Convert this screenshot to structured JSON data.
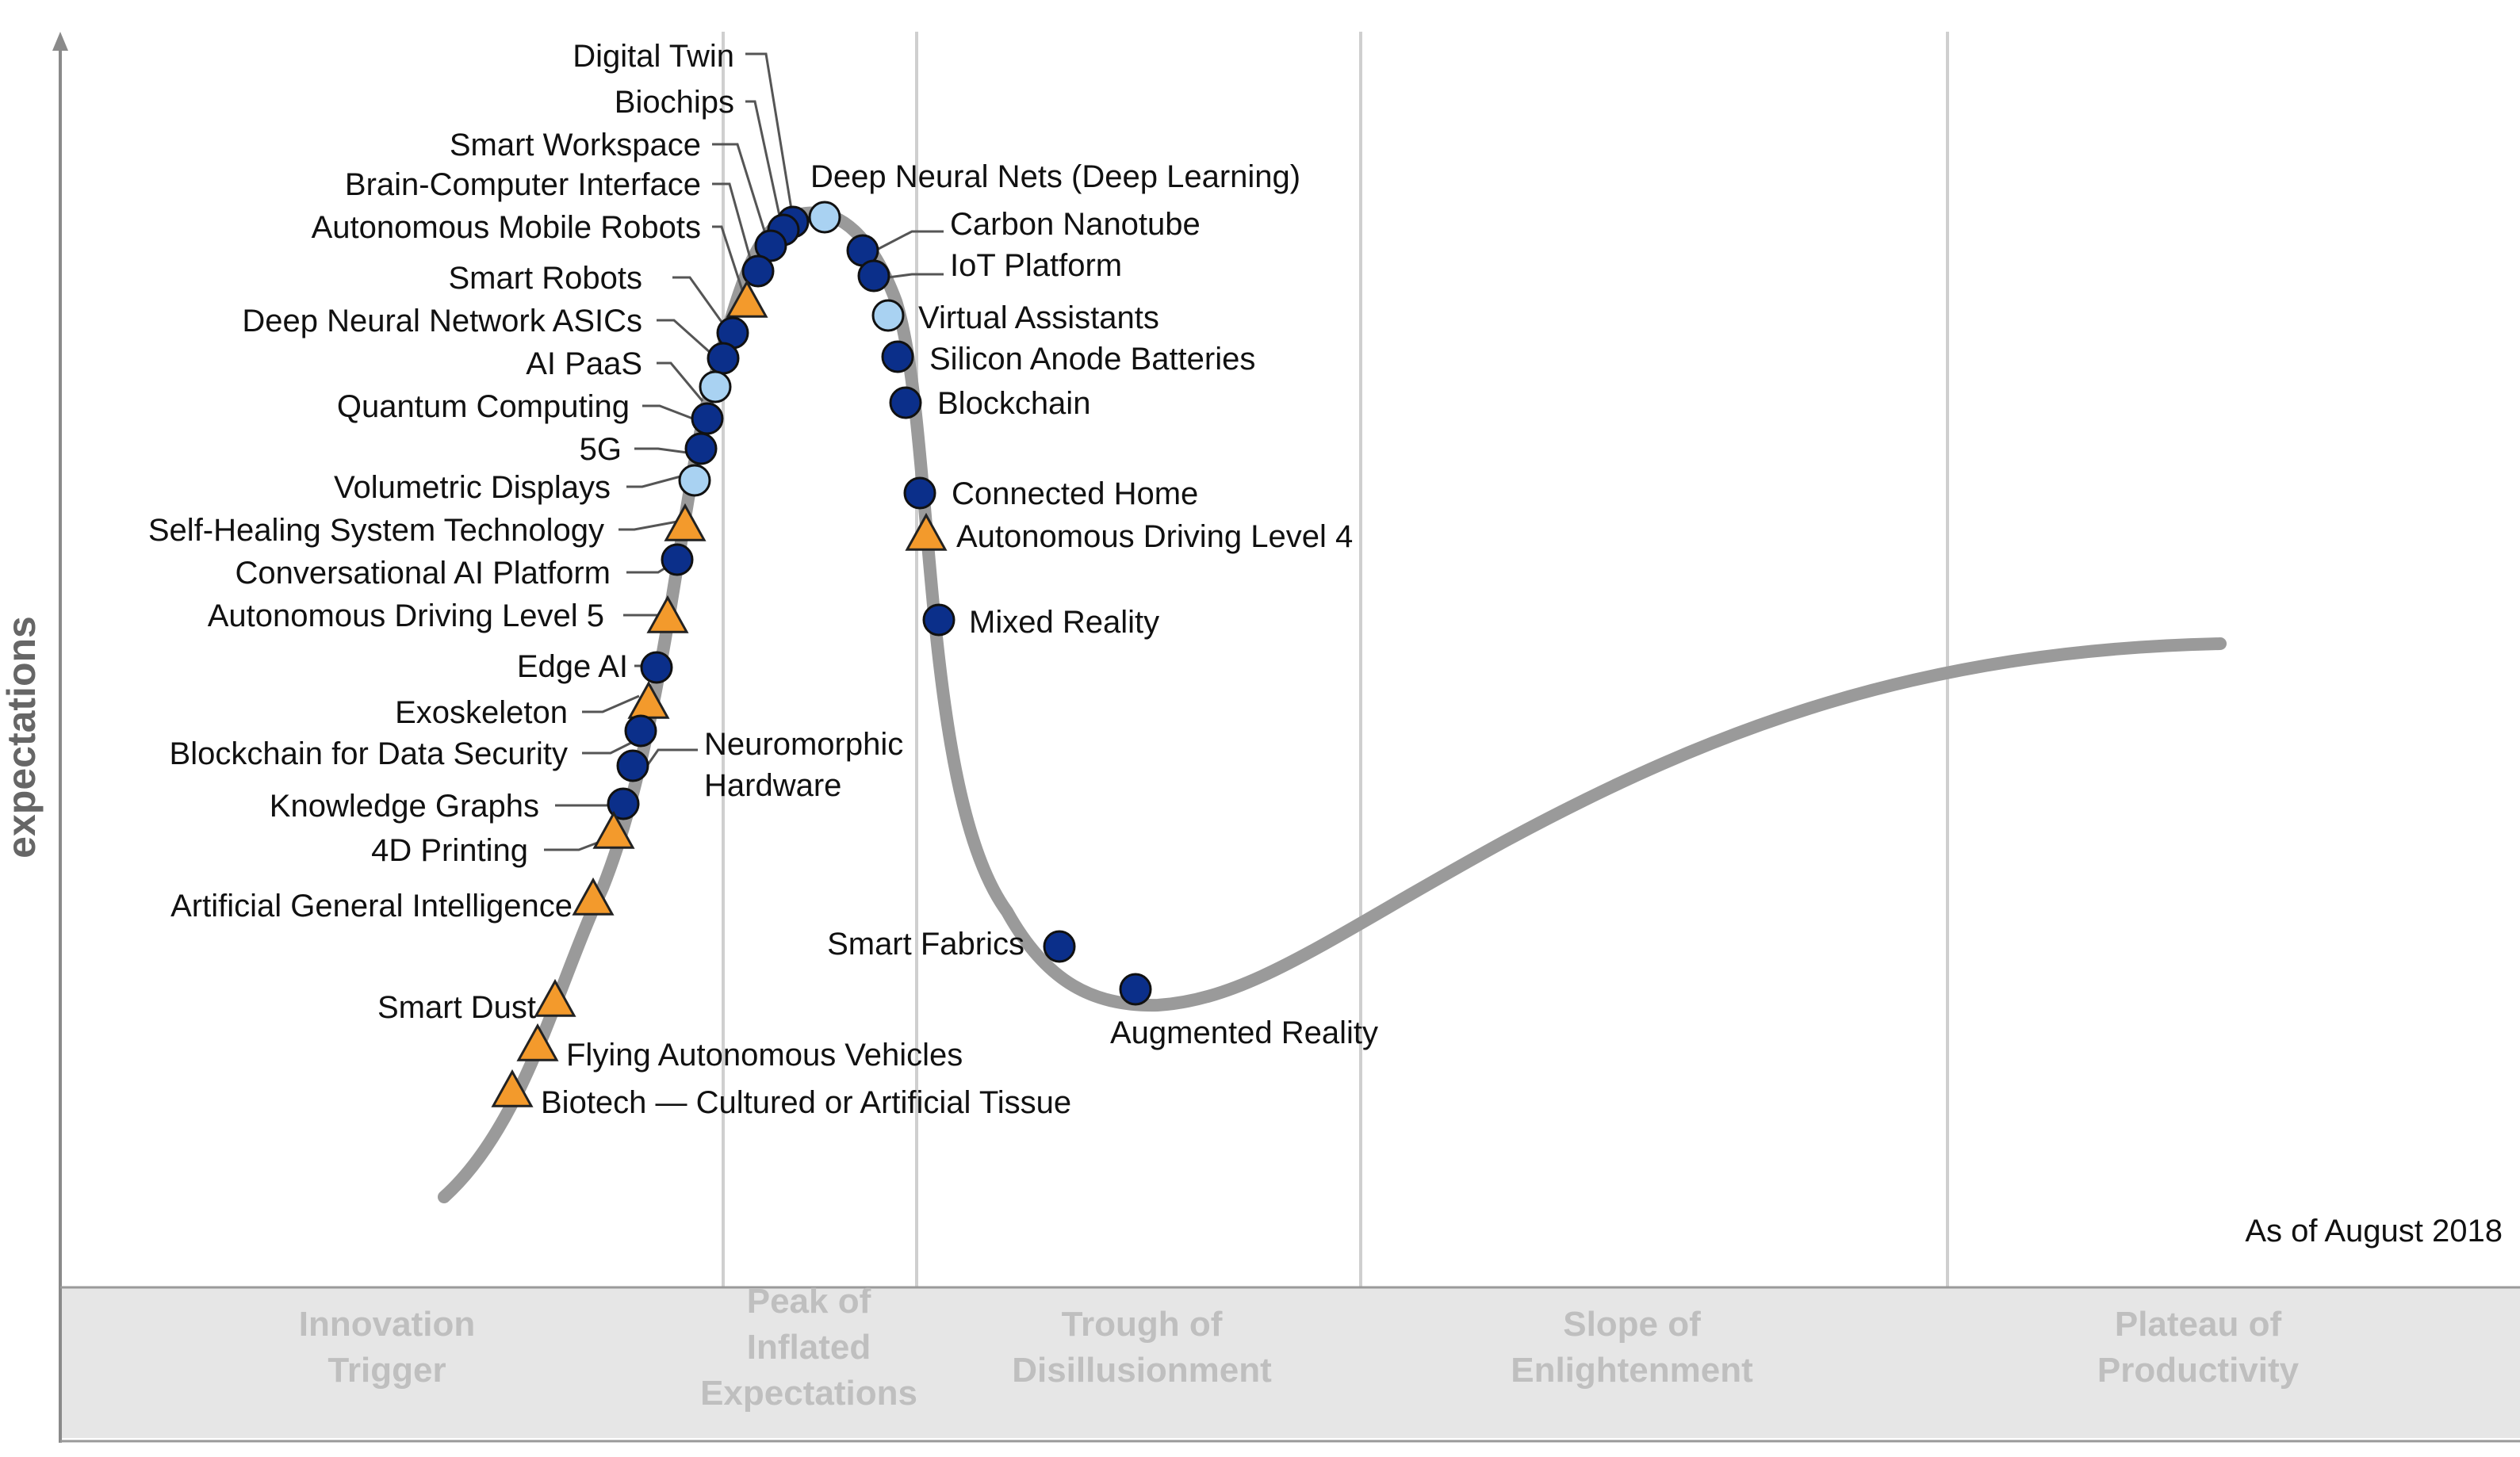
{
  "y_axis_label": "expectations",
  "as_of": "As of August 2018",
  "phases": [
    {
      "lines": [
        "Innovation",
        "Trigger"
      ]
    },
    {
      "lines": [
        "Peak of",
        "Inflated",
        "Expectations"
      ]
    },
    {
      "lines": [
        "Trough of",
        "Disillusionment"
      ]
    },
    {
      "lines": [
        "Slope of",
        "Enlightenment"
      ]
    },
    {
      "lines": [
        "Plateau of",
        "Productivity"
      ]
    }
  ],
  "legend_markers": {
    "dark_circle": "#0b2f8a",
    "light_circle": "#a9d2f2",
    "triangle": "#f39a2c",
    "curve": "#9a9a9a"
  },
  "technologies": [
    {
      "id": "digital-twin",
      "name": "Digital Twin",
      "marker": "dark_circle"
    },
    {
      "id": "biochips",
      "name": "Biochips",
      "marker": "dark_circle"
    },
    {
      "id": "smart-workspace",
      "name": "Smart Workspace",
      "marker": "dark_circle"
    },
    {
      "id": "brain-computer-interface",
      "name": "Brain-Computer Interface",
      "marker": "dark_circle"
    },
    {
      "id": "autonomous-mobile-robots",
      "name": "Autonomous Mobile Robots",
      "marker": "triangle"
    },
    {
      "id": "smart-robots",
      "name": "Smart Robots",
      "marker": "dark_circle"
    },
    {
      "id": "deep-neural-network-asics",
      "name": "Deep Neural Network ASICs",
      "marker": "dark_circle"
    },
    {
      "id": "ai-paas",
      "name": "AI PaaS",
      "marker": "light_circle"
    },
    {
      "id": "quantum-computing",
      "name": "Quantum Computing",
      "marker": "dark_circle"
    },
    {
      "id": "5g",
      "name": "5G",
      "marker": "dark_circle"
    },
    {
      "id": "volumetric-displays",
      "name": "Volumetric Displays",
      "marker": "light_circle"
    },
    {
      "id": "self-healing-system-technology",
      "name": "Self-Healing System Technology",
      "marker": "triangle"
    },
    {
      "id": "conversational-ai-platform",
      "name": "Conversational AI Platform",
      "marker": "dark_circle"
    },
    {
      "id": "autonomous-driving-level-5",
      "name": "Autonomous Driving Level 5",
      "marker": "triangle"
    },
    {
      "id": "edge-ai",
      "name": "Edge AI",
      "marker": "dark_circle"
    },
    {
      "id": "exoskeleton",
      "name": "Exoskeleton",
      "marker": "triangle"
    },
    {
      "id": "blockchain-for-data-security",
      "name": "Blockchain for Data Security",
      "marker": "dark_circle"
    },
    {
      "id": "neuromorphic-hardware",
      "name": "Neuromorphic Hardware",
      "marker": "dark_circle"
    },
    {
      "id": "knowledge-graphs",
      "name": "Knowledge Graphs",
      "marker": "dark_circle"
    },
    {
      "id": "4d-printing",
      "name": "4D Printing",
      "marker": "triangle"
    },
    {
      "id": "artificial-general-intelligence",
      "name": "Artificial General Intelligence",
      "marker": "triangle"
    },
    {
      "id": "smart-dust",
      "name": "Smart Dust",
      "marker": "triangle"
    },
    {
      "id": "flying-autonomous-vehicles",
      "name": "Flying Autonomous Vehicles",
      "marker": "triangle"
    },
    {
      "id": "biotech-cultured-or-artificial-tissue",
      "name": "Biotech — Cultured or Artificial Tissue",
      "marker": "triangle"
    },
    {
      "id": "deep-neural-nets",
      "name": "Deep Neural Nets (Deep Learning)",
      "marker": "light_circle"
    },
    {
      "id": "carbon-nanotube",
      "name": "Carbon Nanotube",
      "marker": "dark_circle"
    },
    {
      "id": "iot-platform",
      "name": "IoT Platform",
      "marker": "dark_circle"
    },
    {
      "id": "virtual-assistants",
      "name": "Virtual Assistants",
      "marker": "light_circle"
    },
    {
      "id": "silicon-anode-batteries",
      "name": "Silicon Anode Batteries",
      "marker": "dark_circle"
    },
    {
      "id": "blockchain",
      "name": "Blockchain",
      "marker": "dark_circle"
    },
    {
      "id": "connected-home",
      "name": "Connected Home",
      "marker": "dark_circle"
    },
    {
      "id": "autonomous-driving-level-4",
      "name": "Autonomous Driving Level 4",
      "marker": "triangle"
    },
    {
      "id": "mixed-reality",
      "name": "Mixed Reality",
      "marker": "dark_circle"
    },
    {
      "id": "smart-fabrics",
      "name": "Smart Fabrics",
      "marker": "dark_circle"
    },
    {
      "id": "augmented-reality",
      "name": "Augmented Reality",
      "marker": "dark_circle"
    }
  ]
}
